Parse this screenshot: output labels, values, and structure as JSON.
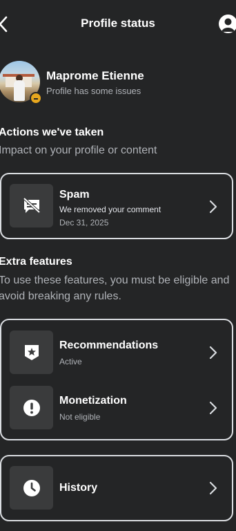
{
  "header": {
    "title": "Profile status"
  },
  "profile": {
    "name": "Maprome Etienne",
    "status": "Profile has some issues"
  },
  "actions": {
    "title": "Actions we've taken",
    "description": "Impact on your profile or content",
    "items": [
      {
        "title": "Spam",
        "detail": "We removed your comment",
        "date": "Dec 31, 2025",
        "icon": "comment-off-icon"
      }
    ]
  },
  "features": {
    "title": "Extra features",
    "description": "To use these features, you must be eligible and avoid breaking any rules.",
    "items": [
      {
        "title": "Recommendations",
        "status": "Active",
        "icon": "star-badge-icon"
      },
      {
        "title": "Monetization",
        "status": "Not eligible",
        "icon": "alert-circle-icon"
      }
    ]
  },
  "history": {
    "title": "History",
    "icon": "clock-icon"
  },
  "colors": {
    "background": "#242526",
    "card_border": "#dadde1",
    "icon_tile": "#3a3b3c",
    "warning": "#e7a71e"
  }
}
